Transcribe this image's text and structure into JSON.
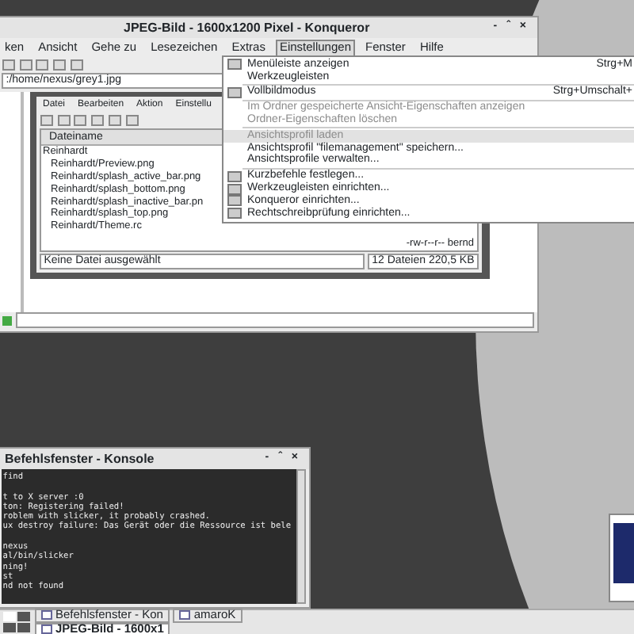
{
  "konqueror": {
    "title": "JPEG-Bild - 1600x1200 Pixel - Konqueror",
    "controls": [
      "-",
      "ˆ",
      "×"
    ],
    "menus": [
      {
        "label": "ken",
        "selected": false
      },
      {
        "label": "Ansicht",
        "selected": false
      },
      {
        "label": "Gehe zu",
        "selected": false
      },
      {
        "label": "Lesezeichen",
        "selected": false
      },
      {
        "label": "Extras",
        "selected": false
      },
      {
        "label": "Einstellungen",
        "selected": true
      },
      {
        "label": "Fenster",
        "selected": false
      },
      {
        "label": "Hilfe",
        "selected": false
      }
    ],
    "location": ":/home/nexus/grey1.jpg",
    "image": {
      "menus": [
        "Datei",
        "Bearbeiten",
        "Aktion",
        "Einstellu"
      ],
      "column": "Dateiname",
      "files": [
        {
          "name": "Reinhardt",
          "children": [
            {
              "name": "Reinhardt/Preview.png"
            },
            {
              "name": "Reinhardt/splash_active_bar.png"
            },
            {
              "name": "Reinhardt/splash_bottom.png"
            },
            {
              "name": "Reinhardt/splash_inactive_bar.pn"
            },
            {
              "name": "Reinhardt/splash_top.png"
            },
            {
              "name": "Reinhardt/Theme.rc"
            }
          ]
        }
      ],
      "permissions": "-rw-r--r-- bernd",
      "status_left": "Keine Datei ausgewählt",
      "status_right": "12 Dateien  220,5 KB"
    }
  },
  "settings_menu": [
    {
      "kind": "item",
      "label": "Menüleiste anzeigen",
      "shortcut": "Strg+M",
      "icon": true,
      "disabled": false,
      "selected": false
    },
    {
      "kind": "item",
      "label": "Werkzeugleisten",
      "disabled": false,
      "selected": false
    },
    {
      "kind": "separator"
    },
    {
      "kind": "item",
      "label": "Vollbildmodus",
      "shortcut": "Strg+Umschalt+",
      "icon": true,
      "disabled": false,
      "selected": false
    },
    {
      "kind": "separator"
    },
    {
      "kind": "item",
      "label": "Im Ordner gespeicherte Ansicht-Eigenschaften anzeigen",
      "disabled": true,
      "selected": false
    },
    {
      "kind": "item",
      "label": "Ordner-Eigenschaften löschen",
      "disabled": true,
      "selected": false
    },
    {
      "kind": "separator"
    },
    {
      "kind": "item",
      "label": "Ansichtsprofil laden",
      "disabled": true,
      "selected": true
    },
    {
      "kind": "item",
      "label": "Ansichtsprofil \"filemanagement\" speichern...",
      "disabled": false,
      "selected": false
    },
    {
      "kind": "item",
      "label": "Ansichtsprofile verwalten...",
      "disabled": false,
      "selected": false
    },
    {
      "kind": "separator"
    },
    {
      "kind": "item",
      "label": "Kurzbefehle festlegen...",
      "icon": true,
      "disabled": false,
      "selected": false
    },
    {
      "kind": "item",
      "label": "Werkzeugleisten einrichten...",
      "icon": true,
      "disabled": false,
      "selected": false
    },
    {
      "kind": "item",
      "label": "Konqueror einrichten...",
      "icon": true,
      "disabled": false,
      "selected": false
    },
    {
      "kind": "item",
      "label": "Rechtschreibprüfung einrichten...",
      "icon": true,
      "disabled": false,
      "selected": false
    }
  ],
  "konsole": {
    "title": "Befehlsfenster - Konsole",
    "controls": [
      "-",
      "ˆ",
      "×"
    ],
    "paragraphs": [
      [
        "find"
      ],
      [
        "t to X server :0",
        "ton: Registering failed!",
        "roblem with slicker, it probably crashed.",
        "ux destroy failure: Das Gerät oder die Ressource ist bele"
      ],
      [
        "nexus",
        "al/bin/slicker",
        "ning!",
        "st",
        "nd not found"
      ]
    ]
  },
  "taskbar": {
    "tasks": [
      {
        "label": "Befehlsfenster - Kon",
        "selected": false
      },
      {
        "label": "amaroK",
        "selected": false
      },
      {
        "label": "JPEG-Bild - 1600x1",
        "selected": true
      }
    ]
  }
}
